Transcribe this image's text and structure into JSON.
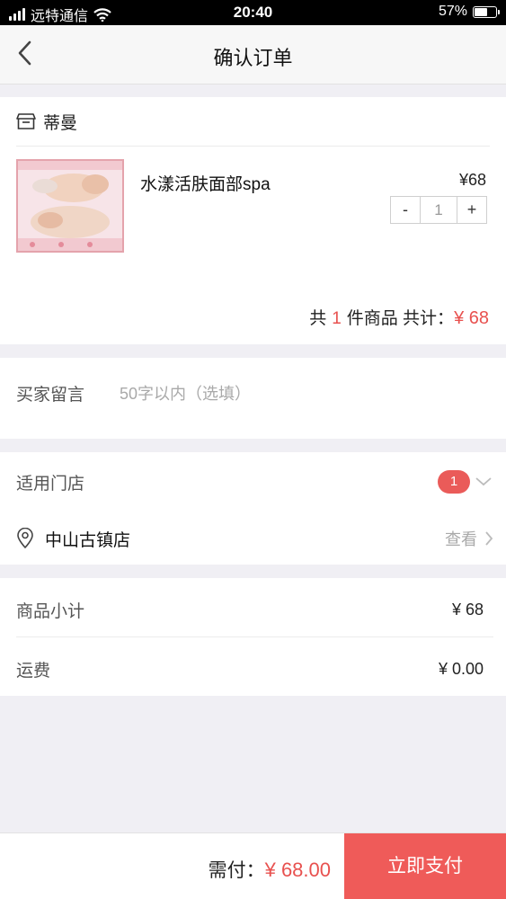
{
  "status_bar": {
    "carrier": "远特通信",
    "time": "20:40",
    "battery_text": "57%",
    "battery_level": 0.57
  },
  "nav": {
    "title": "确认订单"
  },
  "shop": {
    "name": "蒂曼"
  },
  "product": {
    "name": "水漾活肤面部spa",
    "price": "¥68",
    "quantity": "1",
    "minus": "-",
    "plus": "+"
  },
  "summary": {
    "prefix": "共",
    "count": "1",
    "mid": "件商品 共计：",
    "total": "¥ 68"
  },
  "message": {
    "label": "买家留言",
    "placeholder": "50字以内（选填）"
  },
  "stores": {
    "label": "适用门店",
    "count": "1",
    "store_name": "中山古镇店",
    "view": "查看"
  },
  "fees": {
    "subtotal_label": "商品小计",
    "subtotal_value": "¥ 68",
    "shipping_label": "运费",
    "shipping_value": "¥ 0.00"
  },
  "bottom": {
    "pay_label": "需付：",
    "pay_amount": "¥ 68.00",
    "pay_button": "立即支付"
  },
  "colors": {
    "accent": "#ef5b59",
    "price_red": "#e8514f",
    "badge": "#ea5b59"
  }
}
